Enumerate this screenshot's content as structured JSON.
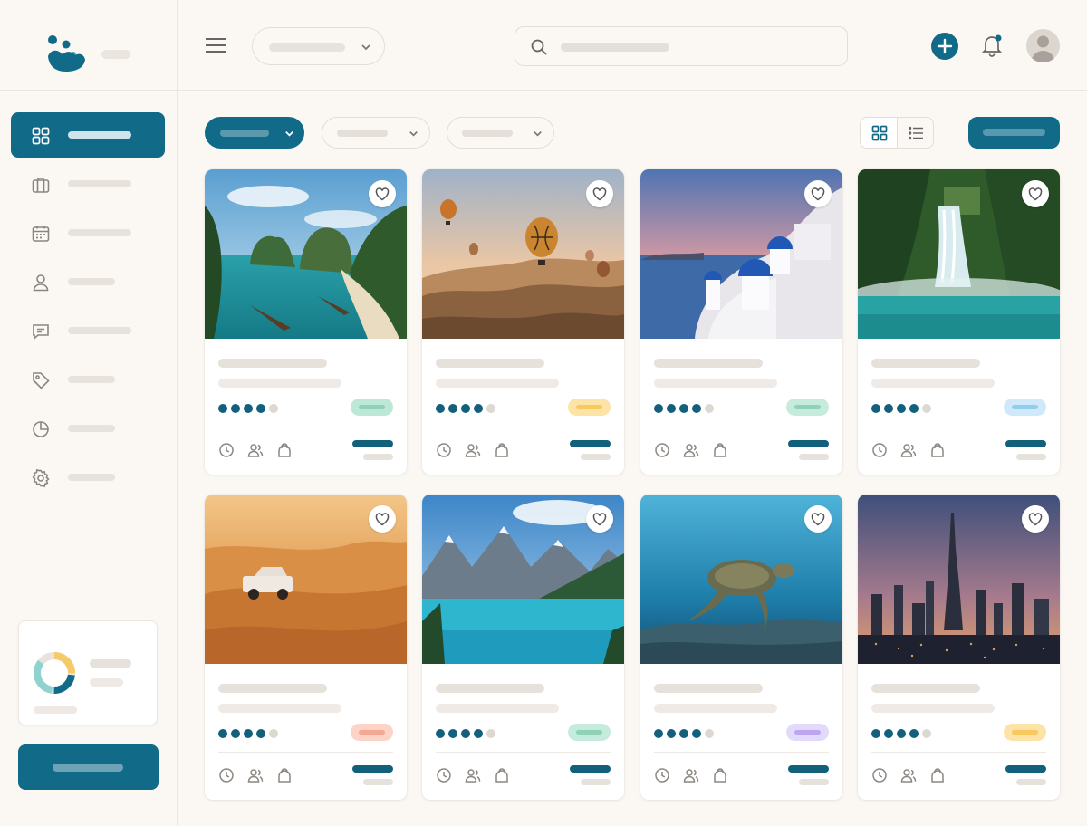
{
  "colors": {
    "accent": "#116a88",
    "background": "#fbf8f4"
  },
  "sidebar": {
    "items": [
      {
        "icon": "grid-icon",
        "active": true
      },
      {
        "icon": "briefcase-icon",
        "active": false
      },
      {
        "icon": "calendar-icon",
        "active": false
      },
      {
        "icon": "user-icon",
        "active": false
      },
      {
        "icon": "message-icon",
        "active": false
      },
      {
        "icon": "tag-icon",
        "active": false
      },
      {
        "icon": "pie-chart-icon",
        "active": false
      },
      {
        "icon": "gear-icon",
        "active": false
      }
    ]
  },
  "header": {
    "icons": [
      "menu-icon",
      "chevron-down-icon",
      "search-icon",
      "plus-icon",
      "bell-icon",
      "avatar"
    ]
  },
  "filters": {
    "icons": [
      "chevron-down-icon",
      "grid-view-icon",
      "list-view-icon"
    ]
  },
  "cards": [
    {
      "image": "tropical-beach-cliffs",
      "rating": 4,
      "badge_color": "#bde7d6",
      "badge_fill": "#8fd2b7"
    },
    {
      "image": "hot-air-balloons",
      "rating": 4,
      "badge_color": "#fde3a6",
      "badge_fill": "#f7c95f"
    },
    {
      "image": "santorini",
      "rating": 4,
      "badge_color": "#c5ebdc",
      "badge_fill": "#8fd2b7"
    },
    {
      "image": "jungle-waterfall",
      "rating": 4,
      "badge_color": "#cfe9fa",
      "badge_fill": "#93cdee"
    },
    {
      "image": "desert-dunes-jeep",
      "rating": 4,
      "badge_color": "#fcd3c6",
      "badge_fill": "#f3a893"
    },
    {
      "image": "mountain-lake",
      "rating": 4,
      "badge_color": "#c5ebdc",
      "badge_fill": "#8fd2b7"
    },
    {
      "image": "sea-turtle",
      "rating": 4,
      "badge_color": "#e3dafb",
      "badge_fill": "#bca6f1"
    },
    {
      "image": "city-skyline-dusk",
      "rating": 4,
      "badge_color": "#fde3a6",
      "badge_fill": "#f7c95f"
    }
  ]
}
